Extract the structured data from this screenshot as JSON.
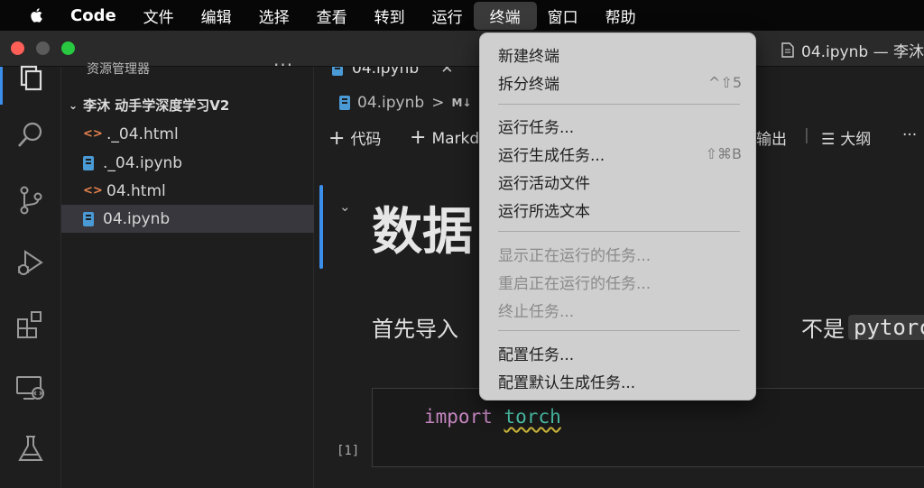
{
  "menubar": {
    "app": "Code",
    "items": [
      "文件",
      "编辑",
      "选择",
      "查看",
      "转到",
      "运行",
      "终端",
      "窗口",
      "帮助"
    ],
    "active": "终端"
  },
  "window": {
    "title": "04.ipynb — 李沐"
  },
  "sidebar": {
    "header": "资源管理器",
    "folder": "李沐 动手学深度学习V2",
    "files": [
      {
        "name": "._04.html",
        "type": "html"
      },
      {
        "name": "._04.ipynb",
        "type": "notebook"
      },
      {
        "name": "04.html",
        "type": "html"
      },
      {
        "name": "04.ipynb",
        "type": "notebook",
        "selected": true
      }
    ]
  },
  "editor": {
    "tab": "04.ipynb",
    "breadcrumb": {
      "file": "04.ipynb",
      "sep": ">",
      "md": "M↓"
    },
    "toolbar": {
      "code": "代码",
      "markdown": "Markd",
      "outline": "大纲",
      "output": "输出",
      "more": "···"
    },
    "heading": "数据",
    "paragraph_start": "首先导入",
    "paragraph_end": "不是",
    "inline_code": "pytorch",
    "code": {
      "keyword": "import",
      "module": "torch"
    },
    "exec_count": "[1]"
  },
  "terminal_menu": {
    "groups": [
      [
        {
          "label": "新建终端",
          "shortcut": "",
          "disabled": false
        },
        {
          "label": "拆分终端",
          "shortcut": "^⇧5",
          "disabled": false
        }
      ],
      [
        {
          "label": "运行任务...",
          "shortcut": "",
          "disabled": false
        },
        {
          "label": "运行生成任务...",
          "shortcut": "⇧⌘B",
          "disabled": false
        },
        {
          "label": "运行活动文件",
          "shortcut": "",
          "disabled": false
        },
        {
          "label": "运行所选文本",
          "shortcut": "",
          "disabled": false
        }
      ],
      [
        {
          "label": "显示正在运行的任务...",
          "shortcut": "",
          "disabled": true
        },
        {
          "label": "重启正在运行的任务...",
          "shortcut": "",
          "disabled": true
        },
        {
          "label": "终止任务...",
          "shortcut": "",
          "disabled": true
        }
      ],
      [
        {
          "label": "配置任务...",
          "shortcut": "",
          "disabled": false
        },
        {
          "label": "配置默认生成任务...",
          "shortcut": "",
          "disabled": false
        }
      ]
    ]
  },
  "colors": {
    "accent": "#3b8eea",
    "close": "#ff5f57",
    "minimize": "#febc2e",
    "zoom": "#28c840"
  }
}
